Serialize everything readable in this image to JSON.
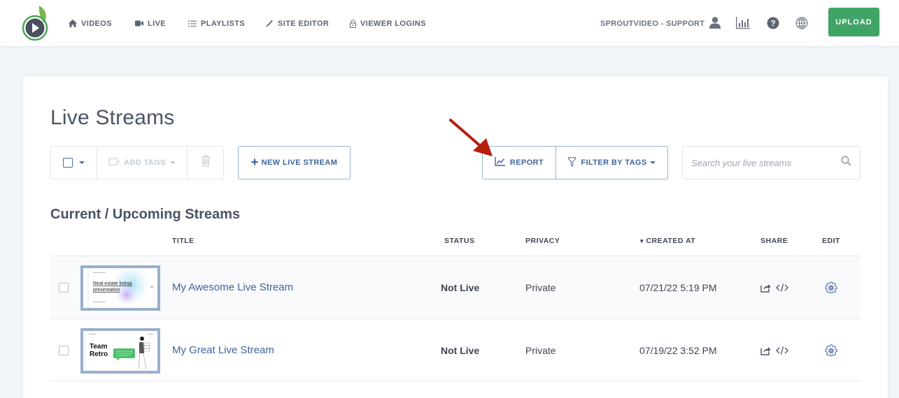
{
  "header": {
    "logo_alt": "SproutVideo",
    "nav": [
      {
        "label": "VIDEOS",
        "icon": "home-icon"
      },
      {
        "label": "LIVE",
        "icon": "video-camera-icon"
      },
      {
        "label": "PLAYLISTS",
        "icon": "list-icon"
      },
      {
        "label": "SITE EDITOR",
        "icon": "magic-wand-icon"
      },
      {
        "label": "VIEWER LOGINS",
        "icon": "lock-icon"
      }
    ],
    "account_label": "SPROUTVIDEO - SUPPORT",
    "upload_label": "UPLOAD",
    "colors": {
      "upload": "#3fa466",
      "accent": "#3f659c"
    }
  },
  "page": {
    "title": "Live Streams",
    "toolbar": {
      "add_tags_label": "ADD TAGS",
      "new_stream_label": "NEW LIVE STREAM",
      "report_label": "REPORT",
      "filter_label": "FILTER BY TAGS",
      "search_placeholder": "Search your live streams",
      "search_value": ""
    },
    "section_title": "Current / Upcoming Streams",
    "columns": {
      "title": "TITLE",
      "status": "STATUS",
      "privacy": "PRIVACY",
      "created_at": "CREATED AT",
      "share": "SHARE",
      "edit": "EDIT"
    },
    "sort": {
      "column": "created_at",
      "direction": "desc",
      "indicator": "▾"
    },
    "streams": [
      {
        "title": "My Awesome Live Stream",
        "status": "Not Live",
        "privacy": "Private",
        "created_at": "07/21/22 5:19 PM",
        "thumbnail_text": "Real estate listing presentation"
      },
      {
        "title": "My Great Live Stream",
        "status": "Not Live",
        "privacy": "Private",
        "created_at": "07/19/22 3:52 PM",
        "thumbnail_text": "Team Retro"
      }
    ]
  }
}
